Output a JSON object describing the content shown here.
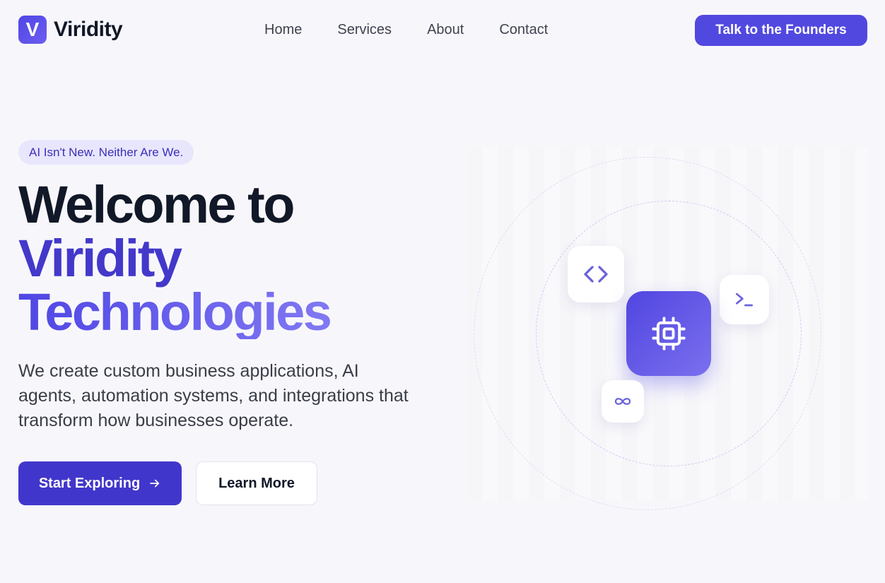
{
  "nav": {
    "logo_letter": "V",
    "brand": "Viridity",
    "links": [
      "Home",
      "Services",
      "About",
      "Contact"
    ],
    "cta": "Talk to the Founders"
  },
  "hero": {
    "badge": "AI Isn't New. Neither Are We.",
    "headline": {
      "line1": "Welcome to",
      "line2": "Viridity",
      "line3": "Technologies"
    },
    "subtitle": "We create custom business applications, AI agents, automation systems, and integrations that transform how businesses operate.",
    "primary_button": "Start Exploring",
    "secondary_button": "Learn More"
  },
  "visual": {
    "icons": [
      "code-icon",
      "terminal-icon",
      "cpu-chip-icon",
      "infinity-icon"
    ]
  },
  "colors": {
    "accent": "#5148e0",
    "accent_dark": "#4136cb",
    "accent_light": "#e8e6fc",
    "background": "#f7f7fb"
  }
}
